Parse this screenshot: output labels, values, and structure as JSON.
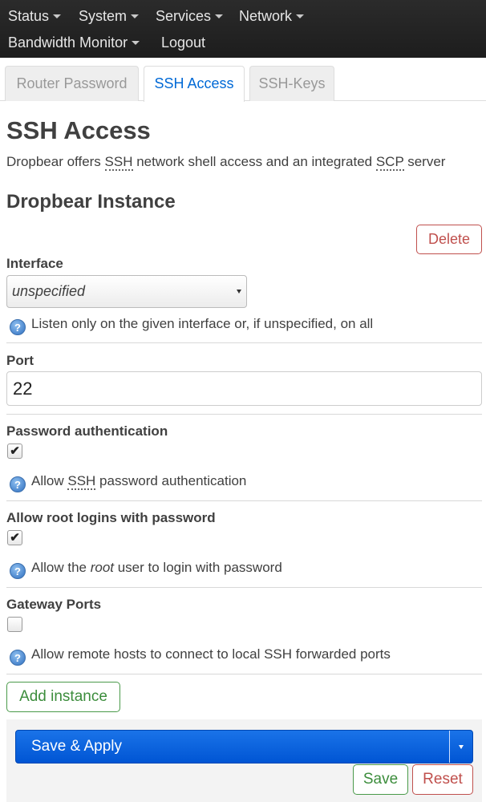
{
  "nav": {
    "status": "Status",
    "system": "System",
    "services": "Services",
    "network": "Network",
    "bandwidth_monitor": "Bandwidth Monitor",
    "logout": "Logout"
  },
  "tabs": [
    {
      "label": "Router Password"
    },
    {
      "label": "SSH Access"
    },
    {
      "label": "SSH-Keys"
    }
  ],
  "page": {
    "title": "SSH Access",
    "desc_part1": "Dropbear offers ",
    "desc_abbr1": "SSH",
    "desc_part2": " network shell access and an integrated ",
    "desc_abbr2": "SCP",
    "desc_part3": " server",
    "section_title": "Dropbear Instance",
    "delete_label": "Delete"
  },
  "fields": {
    "interface": {
      "label": "Interface",
      "value": "unspecified",
      "help": "Listen only on the given interface or, if unspecified, on all"
    },
    "port": {
      "label": "Port",
      "value": "22"
    },
    "password_auth": {
      "label": "Password authentication",
      "checked": true,
      "help_part1": "Allow ",
      "help_abbr": "SSH",
      "help_part2": " password authentication"
    },
    "root_login": {
      "label": "Allow root logins with password",
      "checked": true,
      "help_part1": "Allow the ",
      "help_em": "root",
      "help_part2": " user to login with password"
    },
    "gateway_ports": {
      "label": "Gateway Ports",
      "checked": false,
      "help": "Allow remote hosts to connect to local SSH forwarded ports"
    }
  },
  "actions": {
    "add_instance": "Add instance",
    "save_apply": "Save & Apply",
    "save": "Save",
    "reset": "Reset"
  },
  "icons": {
    "help": "?",
    "check": "✔"
  }
}
